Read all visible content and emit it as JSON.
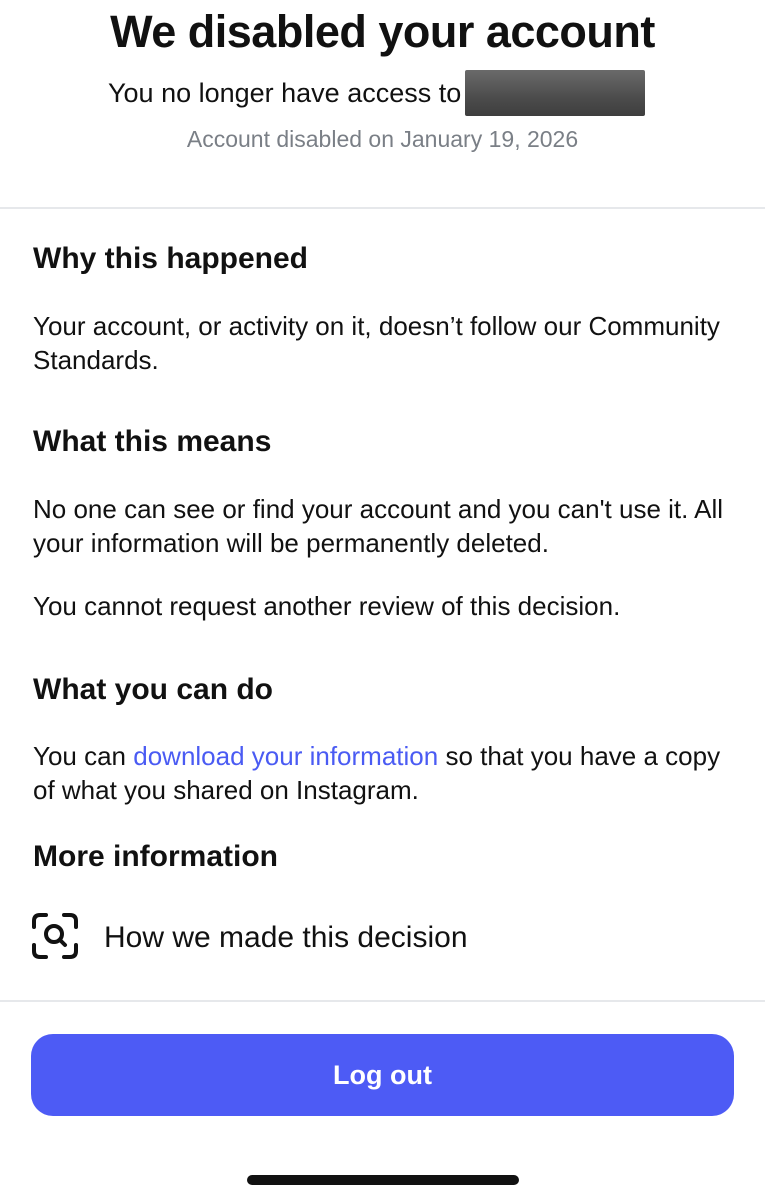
{
  "header": {
    "title": "We disabled your account",
    "access_text": "You no longer have access to",
    "disabled_date": "Account disabled on January 19, 2026"
  },
  "sections": {
    "why": {
      "title": "Why this happened",
      "body": "Your account, or activity on it, doesn’t follow our Community Standards."
    },
    "means": {
      "title": "What this means",
      "body1": "No one can see or find your account and you can't use it. All your information will be permanently deleted.",
      "body2": "You cannot request another review of this decision."
    },
    "can_do": {
      "title": "What you can do",
      "prefix": "You can ",
      "link": "download your information",
      "suffix": " so that you have a copy of what you shared on Instagram."
    },
    "more": {
      "title": "More information",
      "item_label": "How we made this decision",
      "item_icon": "search-scan-icon"
    }
  },
  "actions": {
    "logout_label": "Log out"
  },
  "colors": {
    "accent": "#4d5bf5",
    "link": "#4a5bf3",
    "muted_text": "#7a7f86",
    "divider": "#e6e8eb"
  }
}
